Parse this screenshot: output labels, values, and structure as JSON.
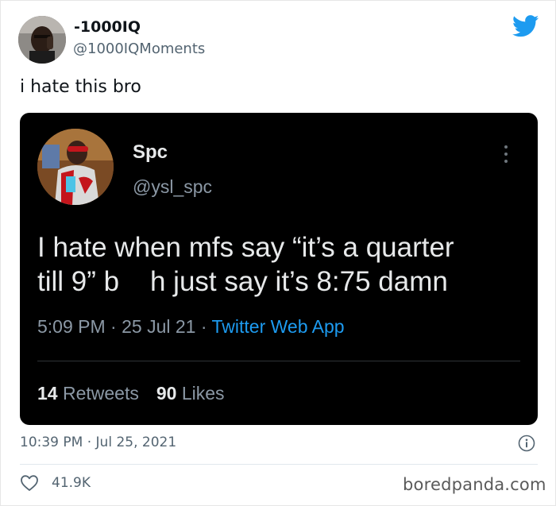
{
  "author": {
    "display_name": "-1000IQ",
    "handle": "@1000IQMoments"
  },
  "tweet": {
    "text": "i hate this bro"
  },
  "quoted_tweet": {
    "display_name": "Spc",
    "handle": "@ysl_spc",
    "body_line1": "I hate when mfs say “it’s a quarter",
    "body_line2": "till 9” b    h just say it’s 8:75 damn",
    "time": "5:09 PM",
    "date": "25 Jul 21",
    "source": "Twitter Web App",
    "retweets_count": "14",
    "retweets_label": "Retweets",
    "likes_count": "90",
    "likes_label": "Likes",
    "menu_icon": "more-vertical-icon"
  },
  "footer": {
    "timestamp": "10:39 PM · Jul 25, 2021",
    "likes": "41.9K",
    "watermark": "boredpanda.com",
    "info_icon": "info-icon",
    "heart_icon": "heart-icon"
  },
  "colors": {
    "twitter_blue": "#1d9bf0",
    "embed_background": "#000000",
    "muted_text": "#536471"
  }
}
